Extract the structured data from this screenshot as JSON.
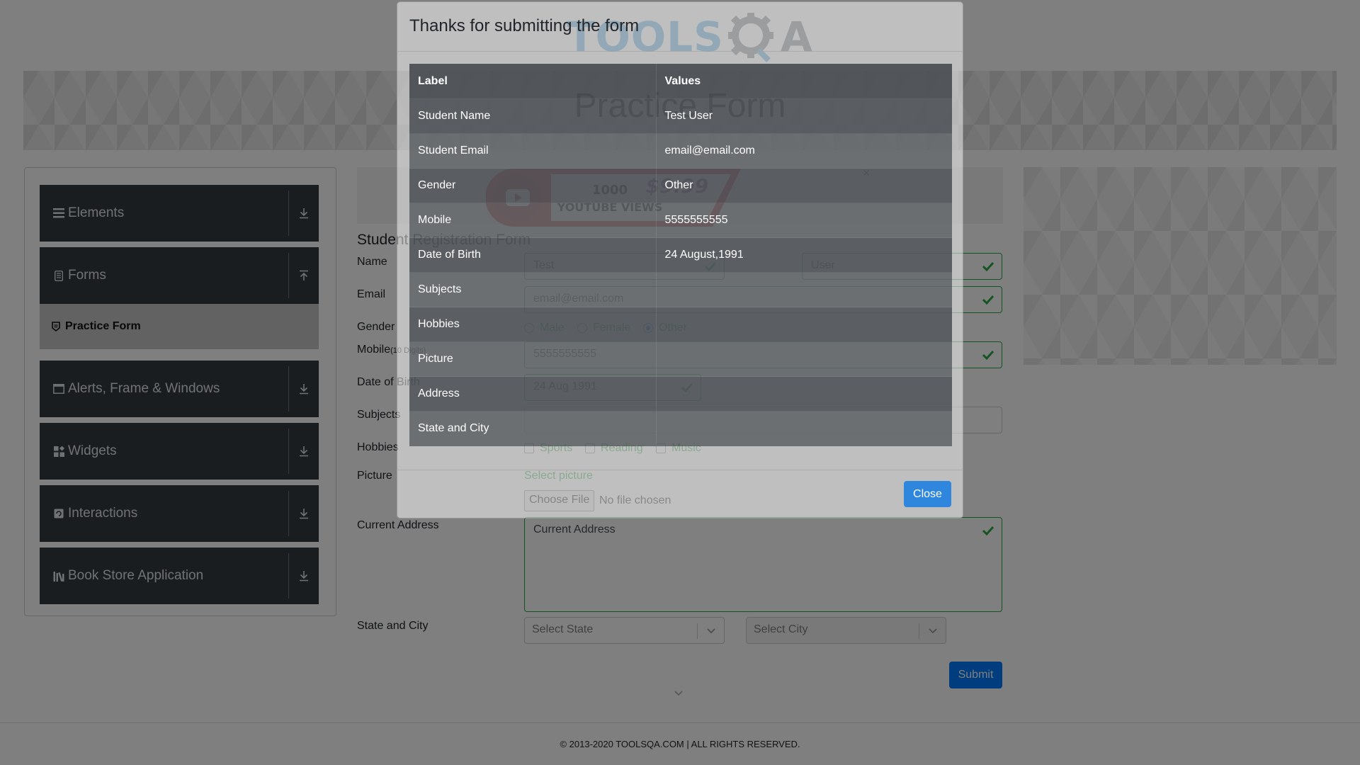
{
  "page": {
    "logo_text": "TOOLS",
    "logo_suffix": "A",
    "banner_title": "Practice Form",
    "footer": "© 2013-2020 TOOLSQA.COM | ALL RIGHTS RESERVED."
  },
  "sidebar": {
    "groups": [
      {
        "label": "Elements",
        "icon": "hamburger-icon",
        "arrow": "download-icon"
      },
      {
        "label": "Forms",
        "icon": "document-icon",
        "arrow": "upload-icon"
      },
      {
        "label": "Alerts, Frame & Windows",
        "icon": "window-icon",
        "arrow": "download-icon"
      },
      {
        "label": "Widgets",
        "icon": "widgets-icon",
        "arrow": "download-icon"
      },
      {
        "label": "Interactions",
        "icon": "interactions-icon",
        "arrow": "download-icon"
      },
      {
        "label": "Book Store Application",
        "icon": "books-icon",
        "arrow": "download-icon"
      }
    ],
    "active_item": "Practice Form"
  },
  "ad": {
    "text_line1": "1000",
    "text_line2": "YOUTUBE VIEWS",
    "price": "$9.99",
    "close": "×"
  },
  "form": {
    "title": "Student Registration Form",
    "labels": {
      "name": "Name",
      "email": "Email",
      "gender": "Gender",
      "mobile": "Mobile",
      "mobile_hint": "(10 Digits)",
      "dob": "Date of Birth",
      "subjects": "Subjects",
      "hobbies": "Hobbies",
      "picture": "Picture",
      "address": "Current Address",
      "state_city": "State and City"
    },
    "first_name": "Test",
    "last_name": "User",
    "email": "email@email.com",
    "genders": [
      "Male",
      "Female",
      "Other"
    ],
    "selected_gender": "Other",
    "mobile": "5555555555",
    "dob": "24 Aug 1991",
    "hobbies": [
      "Sports",
      "Reading",
      "Music"
    ],
    "select_picture": "Select picture",
    "choose_file": "Choose File",
    "no_file": "No file chosen",
    "address_placeholder": "Current Address",
    "state_placeholder": "Select State",
    "city_placeholder": "Select City",
    "submit": "Submit"
  },
  "modal": {
    "title": "Thanks for submitting the form",
    "headers": [
      "Label",
      "Values"
    ],
    "rows": [
      {
        "label": "Student Name",
        "value": "Test User"
      },
      {
        "label": "Student Email",
        "value": "email@email.com"
      },
      {
        "label": "Gender",
        "value": "Other"
      },
      {
        "label": "Mobile",
        "value": "5555555555"
      },
      {
        "label": "Date of Birth",
        "value": "24 August,1991"
      },
      {
        "label": "Subjects",
        "value": ""
      },
      {
        "label": "Hobbies",
        "value": ""
      },
      {
        "label": "Picture",
        "value": ""
      },
      {
        "label": "Address",
        "value": ""
      },
      {
        "label": "State and City",
        "value": ""
      }
    ],
    "close": "Close"
  },
  "colors": {
    "accent": "#007bff",
    "success": "#28a745",
    "sidebar_bg": "#343a40",
    "logo_blue": "#4fa1d9"
  }
}
